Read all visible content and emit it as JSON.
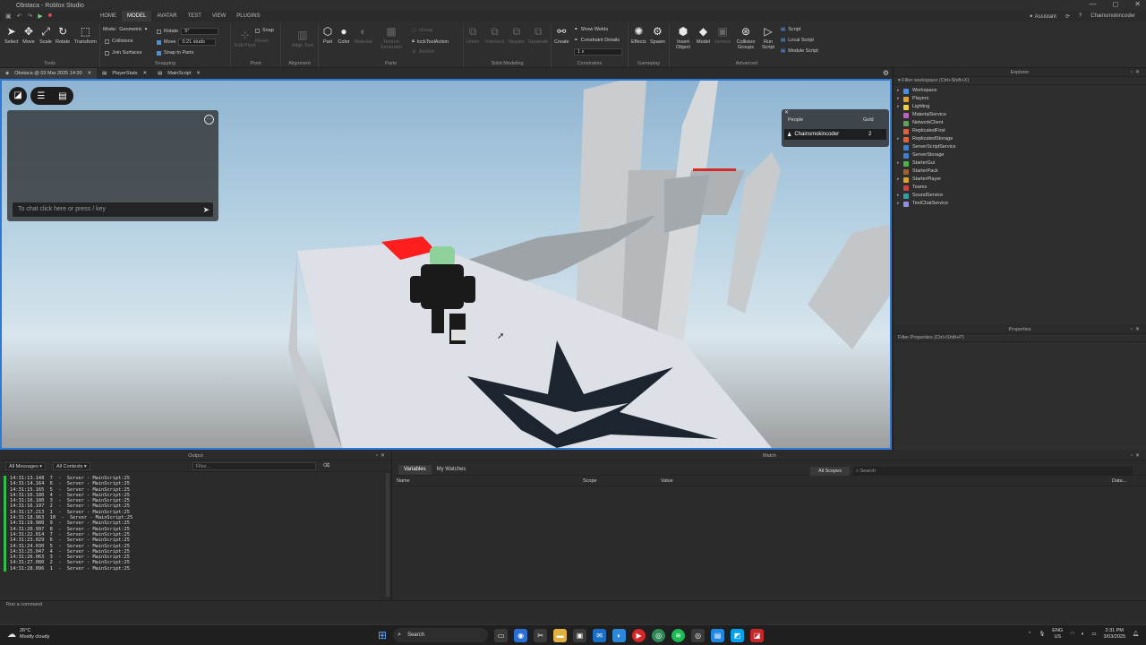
{
  "window": {
    "title": "Obstaca - Roblox Studio",
    "controls": [
      "—",
      "◻",
      "✕"
    ]
  },
  "menu": {
    "tabs": [
      "HOME",
      "MODEL",
      "AVATAR",
      "TEST",
      "VIEW",
      "PLUGINS"
    ],
    "active_tab": "MODEL",
    "assistant": "Assistant",
    "user": "Chainsmokincoder"
  },
  "ribbon": {
    "tools": {
      "select": "Select",
      "move": "Move",
      "scale": "Scale",
      "rotate": "Rotate",
      "transform": "Transform",
      "label": "Tools"
    },
    "snapping": {
      "mode_label": "Mode:",
      "mode_value": "Geometric",
      "collisions": "Collisions",
      "join_surfaces": "Join Surfaces",
      "rotate_label": "Rotate",
      "rotate_value": "5°",
      "move_label": "Move",
      "move_value": "0.21 studs",
      "snap_to_parts": "Snap to Parts",
      "label": "Snapping"
    },
    "pivot": {
      "snap": "Snap",
      "reset": "Reset",
      "edit_pivot": "Edit Pivot",
      "label": "Pivot"
    },
    "alignment": {
      "align_tool": "Align Tool",
      "label": "Alignment"
    },
    "parts": {
      "part": "Part",
      "color": "Color",
      "material": "Material",
      "texture_generator": "Texture Generator",
      "group": "Group",
      "lock": "lockToolAction",
      "anchor": "Anchor",
      "label": "Parts"
    },
    "solid": {
      "union": "Union",
      "intersect": "Intersect",
      "negate": "Negate",
      "separate": "Separate",
      "label": "Solid Modeling"
    },
    "constraints": {
      "create": "Create",
      "show_welds": "Show Welds",
      "constraint_details": "Constraint Details",
      "scale_value": "1 x",
      "label": "Constraints"
    },
    "gameplay": {
      "effects": "Effects",
      "spawn": "Spawn",
      "label": "Gameplay"
    },
    "advanced": {
      "insert_object": "Insert Object",
      "model": "Model",
      "service": "Service",
      "collision_groups": "Collision Groups",
      "run_script": "Run Script",
      "script": "Script",
      "local_script": "Local Script",
      "module_script": "Module Script",
      "label": "Advanced"
    }
  },
  "doc_tabs": [
    {
      "label": "Obstaca @ 03 Mar 2025 14:30"
    },
    {
      "label": "PlayerStats"
    },
    {
      "label": "MainScript"
    }
  ],
  "viewport": {
    "chat_placeholder": "To chat click here or press / key",
    "leaderboard": {
      "people": "People",
      "stat": "Gold",
      "player": "Chainsmokincoder",
      "value": "2"
    }
  },
  "explorer": {
    "title": "Explorer",
    "filter": "Filter workspace (Ctrl+Shift+X)",
    "items": [
      {
        "label": "Workspace",
        "color": "#4a90e2",
        "arrow": "▸"
      },
      {
        "label": "Players",
        "color": "#e0a030",
        "arrow": "▸"
      },
      {
        "label": "Lighting",
        "color": "#f0d040",
        "arrow": "▸"
      },
      {
        "label": "MaterialService",
        "color": "#c060c0",
        "arrow": ""
      },
      {
        "label": "NetworkClient",
        "color": "#60a060",
        "arrow": ""
      },
      {
        "label": "ReplicatedFirst",
        "color": "#e06040",
        "arrow": ""
      },
      {
        "label": "ReplicatedStorage",
        "color": "#e06040",
        "arrow": "▸"
      },
      {
        "label": "ServerScriptService",
        "color": "#4080d0",
        "arrow": ""
      },
      {
        "label": "ServerStorage",
        "color": "#4080d0",
        "arrow": ""
      },
      {
        "label": "StarterGui",
        "color": "#50b050",
        "arrow": "▸"
      },
      {
        "label": "StarterPack",
        "color": "#a06030",
        "arrow": ""
      },
      {
        "label": "StarterPlayer",
        "color": "#e0a030",
        "arrow": "▸"
      },
      {
        "label": "Teams",
        "color": "#d04040",
        "arrow": ""
      },
      {
        "label": "SoundService",
        "color": "#30a0a0",
        "arrow": "▸"
      },
      {
        "label": "TextChatService",
        "color": "#9090e0",
        "arrow": "▸"
      }
    ]
  },
  "properties": {
    "title": "Properties",
    "filter": "Filter Properties (Ctrl+Shift+P)"
  },
  "output": {
    "title": "Output",
    "messages_select": "All Messages",
    "contexts_select": "All Contexts",
    "filter_placeholder": "Filter...",
    "lines": [
      "14:31:13.148  7  -  Server - MainScript:25",
      "14:31:14.164  6  -  Server - MainScript:25",
      "14:31:15.165  5  -  Server - MainScript:25",
      "14:31:16.180  4  -  Server - MainScript:25",
      "14:31:16.180  3  -  Server - MainScript:25",
      "14:31:16.197  2  -  Server - MainScript:25",
      "14:31:17.213  1  -  Server - MainScript:25",
      "14:31:18.963  10  -  Server - MainScript:25",
      "14:31:19.980  9  -  Server - MainScript:25",
      "14:31:20.997  8  -  Server - MainScript:25",
      "14:31:22.014  7  -  Server - MainScript:25",
      "14:31:23.029  6  -  Server - MainScript:25",
      "14:31:24.030  5  -  Server - MainScript:25",
      "14:31:25.047  4  -  Server - MainScript:25",
      "14:31:26.063  3  -  Server - MainScript:25",
      "14:31:27.080  2  -  Server - MainScript:25",
      "14:31:28.096  1  -  Server - MainScript:25"
    ]
  },
  "watch": {
    "title": "Watch",
    "tabs": [
      "Variables",
      "My Watches"
    ],
    "scope": "All Scopes",
    "search_placeholder": "Search",
    "columns": [
      "Name",
      "Scope",
      "Value",
      "Data..."
    ]
  },
  "command_bar": {
    "placeholder": "Run a command"
  },
  "taskbar": {
    "weather_temp": "26°C",
    "weather_desc": "Mostly cloudy",
    "search": "Search",
    "lang": "ENG",
    "region": "US",
    "time": "2:31 PM",
    "date": "3/03/2025"
  }
}
